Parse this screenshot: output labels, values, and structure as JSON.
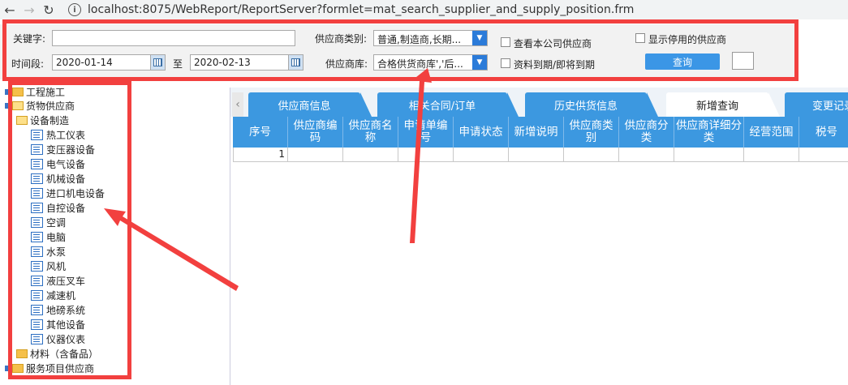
{
  "browser": {
    "back": "←",
    "forward": "→",
    "reload": "↻",
    "url": "localhost:8075/WebReport/ReportServer?formlet=mat_search_supplier_and_supply_position.frm"
  },
  "search": {
    "keyword_label": "关键字:",
    "keyword_value": "",
    "period_label": "时间段:",
    "date_from": "2020-01-14",
    "to_label": "至",
    "date_to": "2020-02-13",
    "supplier_type_label": "供应商类别:",
    "supplier_type_value": "普通,制造商,长期...",
    "supplier_pool_label": "供应商库:",
    "supplier_pool_value": "合格供货商库','后...",
    "chk_own_company": "查看本公司供应商",
    "chk_expiring": "资料到期/即将到期",
    "chk_disabled": "显示停用的供应商",
    "query_button": "查询"
  },
  "tree": {
    "items": [
      {
        "label": "工程施工",
        "type": "folder",
        "level": 0
      },
      {
        "label": "货物供应商",
        "type": "folder-open",
        "level": 0
      },
      {
        "label": "设备制造",
        "type": "folder-open",
        "level": 1
      },
      {
        "label": "热工仪表",
        "type": "doc",
        "level": 2
      },
      {
        "label": "变压器设备",
        "type": "doc",
        "level": 2
      },
      {
        "label": "电气设备",
        "type": "doc",
        "level": 2
      },
      {
        "label": "机械设备",
        "type": "doc",
        "level": 2
      },
      {
        "label": "进口机电设备",
        "type": "doc",
        "level": 2
      },
      {
        "label": "自控设备",
        "type": "doc",
        "level": 2
      },
      {
        "label": "空调",
        "type": "doc",
        "level": 2
      },
      {
        "label": "电脑",
        "type": "doc",
        "level": 2
      },
      {
        "label": "水泵",
        "type": "doc",
        "level": 2
      },
      {
        "label": "风机",
        "type": "doc",
        "level": 2
      },
      {
        "label": "液压叉车",
        "type": "doc",
        "level": 2
      },
      {
        "label": "减速机",
        "type": "doc",
        "level": 2
      },
      {
        "label": "地磅系统",
        "type": "doc",
        "level": 2
      },
      {
        "label": "其他设备",
        "type": "doc",
        "level": 2
      },
      {
        "label": "仪器仪表",
        "type": "doc",
        "level": 2
      },
      {
        "label": "材料（含备品）",
        "type": "folder",
        "level": 1
      },
      {
        "label": "服务项目供应商",
        "type": "folder",
        "level": 0
      }
    ]
  },
  "tabs": [
    {
      "label": "供应商信息",
      "active": false
    },
    {
      "label": "相关合同/订单",
      "active": false
    },
    {
      "label": "历史供货信息",
      "active": false
    },
    {
      "label": "新增查询",
      "active": true
    },
    {
      "label": "变更记录",
      "active": false
    }
  ],
  "tab_scroll": "‹",
  "grid": {
    "headers": [
      "序号",
      "供应商编码",
      "供应商名称",
      "申请单编号",
      "申请状态",
      "新增说明",
      "供应商类别",
      "供应商分类",
      "供应商详细分类",
      "经营范围",
      "税号"
    ],
    "rows": [
      [
        "1",
        "",
        "",
        "",
        "",
        "",
        "",
        "",
        "",
        "",
        ""
      ]
    ]
  },
  "colors": {
    "annotation": "#f2403f",
    "tab_blue": "#3c98e0",
    "query_blue": "#3b96e6"
  }
}
